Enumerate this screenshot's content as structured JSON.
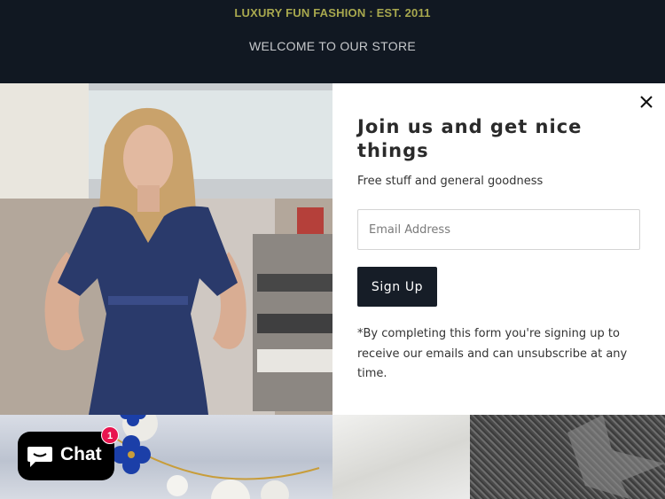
{
  "header": {
    "tagline": "LUXURY FUN FASHION : EST. 2011",
    "welcome": "WELCOME TO OUR STORE"
  },
  "popup": {
    "heading": "Join us and get nice things",
    "subheading": "Free stuff and general goodness",
    "email_placeholder": "Email Address",
    "email_value": "",
    "signup_label": "Sign Up",
    "disclaimer": "*By completing this form you're signing up to receive our emails and can unsubscribe at any time.",
    "close_icon": "close-icon"
  },
  "chat": {
    "label": "Chat",
    "badge_count": "1",
    "icon": "chat-bubble-icon"
  },
  "colors": {
    "header_bg": "#111822",
    "tagline": "#a8a84e",
    "signup_bg": "#161d27",
    "badge": "#e8154f"
  }
}
